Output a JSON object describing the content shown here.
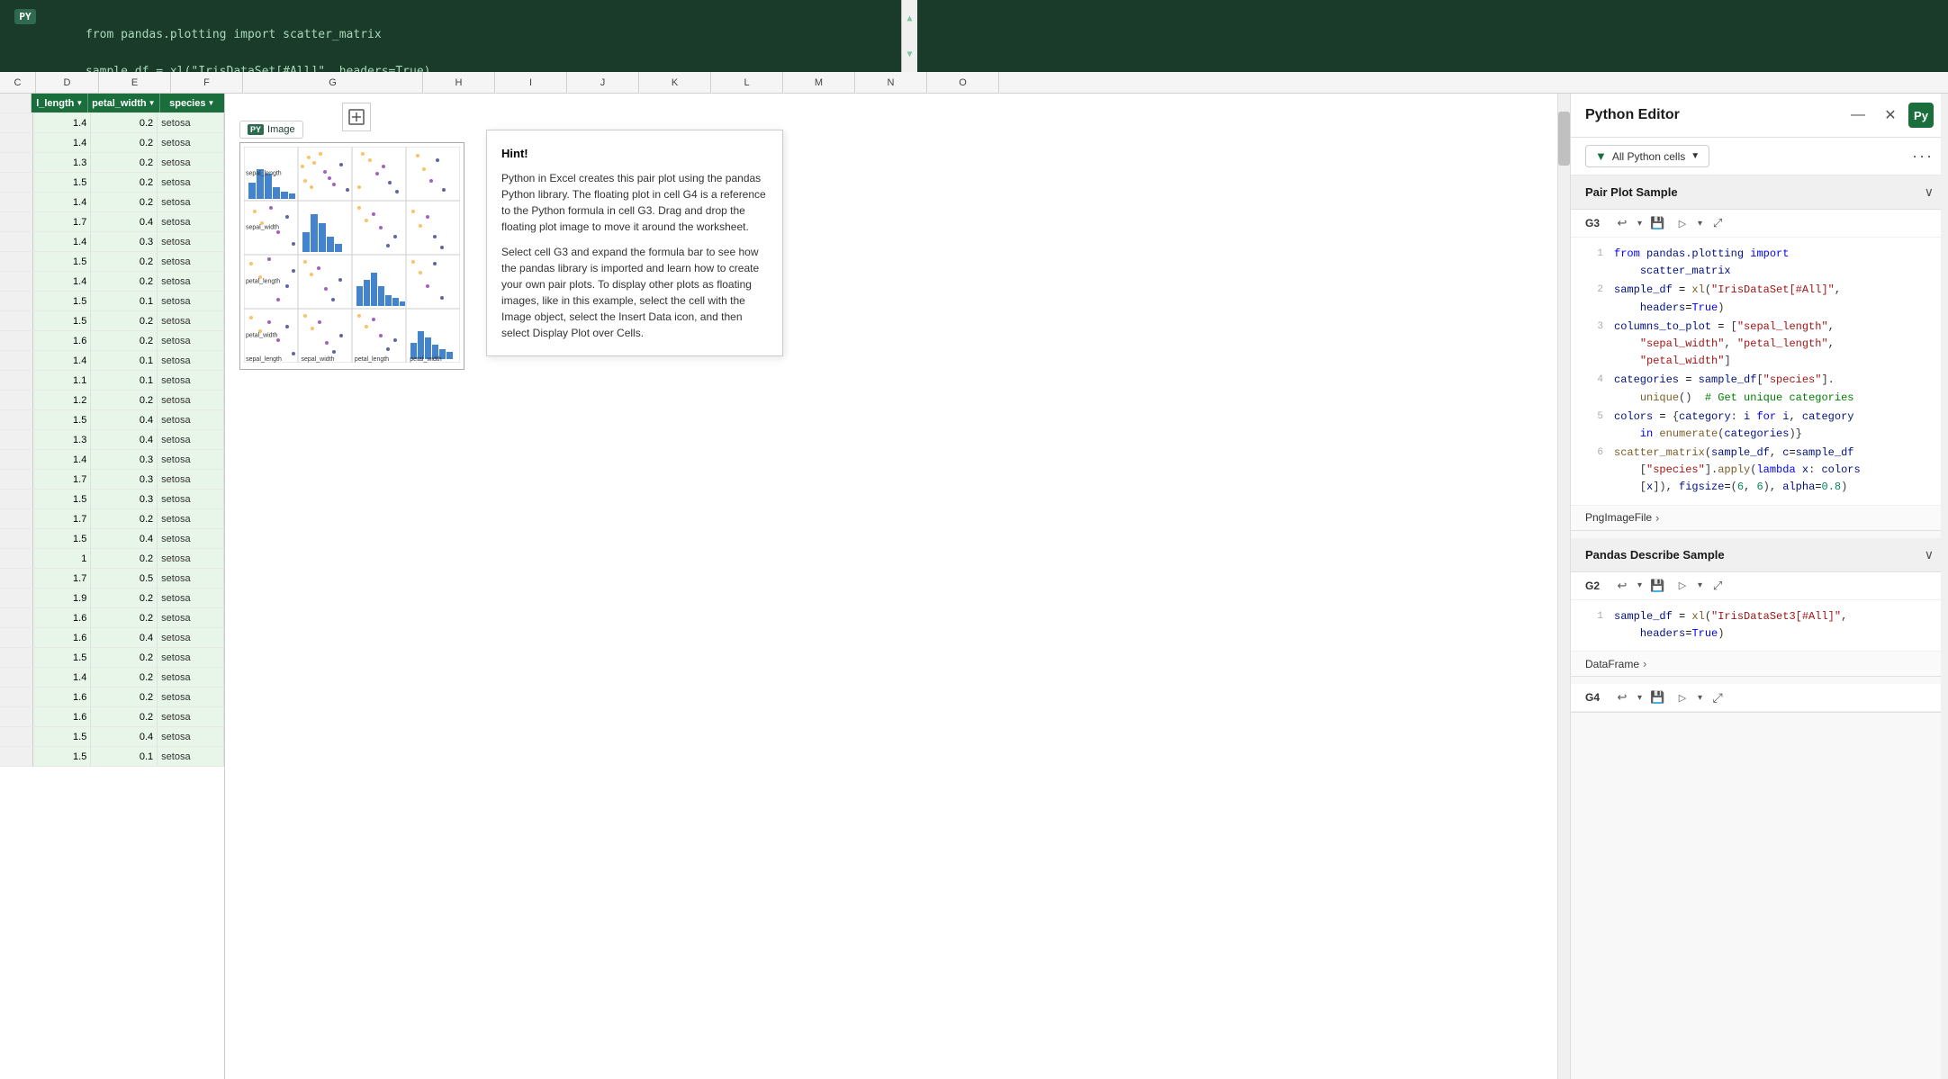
{
  "formula_bar": {
    "py_label": "PY",
    "line1": "from pandas.plotting import scatter_matrix",
    "line2": "sample_df = xl(\"IrisDataSet[#All]\", headers=True)",
    "line3": "columns_to_plot = [\"sepal_length\", \"sepal_width\", \"petal_length\", \"petal_width\"]"
  },
  "spreadsheet": {
    "col_headers": [
      "C",
      "D",
      "E",
      "F",
      "G",
      "H",
      "I",
      "J",
      "K",
      "L",
      "M",
      "N",
      "O"
    ],
    "columns": {
      "petal_length": "l_length",
      "petal_width": "petal_width",
      "species": "species"
    },
    "rows": [
      {
        "petal_length": "1.4",
        "petal_width": "0.2",
        "species": "setosa"
      },
      {
        "petal_length": "1.4",
        "petal_width": "0.2",
        "species": "setosa"
      },
      {
        "petal_length": "1.3",
        "petal_width": "0.2",
        "species": "setosa"
      },
      {
        "petal_length": "1.5",
        "petal_width": "0.2",
        "species": "setosa"
      },
      {
        "petal_length": "1.4",
        "petal_width": "0.2",
        "species": "setosa"
      },
      {
        "petal_length": "1.7",
        "petal_width": "0.4",
        "species": "setosa"
      },
      {
        "petal_length": "1.4",
        "petal_width": "0.3",
        "species": "setosa"
      },
      {
        "petal_length": "1.5",
        "petal_width": "0.2",
        "species": "setosa"
      },
      {
        "petal_length": "1.4",
        "petal_width": "0.2",
        "species": "setosa"
      },
      {
        "petal_length": "1.5",
        "petal_width": "0.1",
        "species": "setosa"
      },
      {
        "petal_length": "1.5",
        "petal_width": "0.2",
        "species": "setosa"
      },
      {
        "petal_length": "1.6",
        "petal_width": "0.2",
        "species": "setosa"
      },
      {
        "petal_length": "1.4",
        "petal_width": "0.1",
        "species": "setosa"
      },
      {
        "petal_length": "1.1",
        "petal_width": "0.1",
        "species": "setosa"
      },
      {
        "petal_length": "1.2",
        "petal_width": "0.2",
        "species": "setosa"
      },
      {
        "petal_length": "1.5",
        "petal_width": "0.4",
        "species": "setosa"
      },
      {
        "petal_length": "1.3",
        "petal_width": "0.4",
        "species": "setosa"
      },
      {
        "petal_length": "1.4",
        "petal_width": "0.3",
        "species": "setosa"
      },
      {
        "petal_length": "1.7",
        "petal_width": "0.3",
        "species": "setosa"
      },
      {
        "petal_length": "1.5",
        "petal_width": "0.3",
        "species": "setosa"
      },
      {
        "petal_length": "1.7",
        "petal_width": "0.2",
        "species": "setosa"
      },
      {
        "petal_length": "1.5",
        "petal_width": "0.4",
        "species": "setosa"
      },
      {
        "petal_length": "1.0",
        "petal_width": "0.2",
        "species": "setosa"
      },
      {
        "petal_length": "1.7",
        "petal_width": "0.5",
        "species": "setosa"
      },
      {
        "petal_length": "1.9",
        "petal_width": "0.2",
        "species": "setosa"
      },
      {
        "petal_length": "1.6",
        "petal_width": "0.2",
        "species": "setosa"
      },
      {
        "petal_length": "1.6",
        "petal_width": "0.4",
        "species": "setosa"
      },
      {
        "petal_length": "1.5",
        "petal_width": "0.2",
        "species": "setosa"
      },
      {
        "petal_length": "1.4",
        "petal_width": "0.2",
        "species": "setosa"
      },
      {
        "petal_length": "1.6",
        "petal_width": "0.2",
        "species": "setosa"
      },
      {
        "petal_length": "1.6",
        "petal_width": "0.2",
        "species": "setosa"
      },
      {
        "petal_length": "1.5",
        "petal_width": "0.4",
        "species": "setosa"
      },
      {
        "petal_length": "1.5",
        "petal_width": "0.1",
        "species": "setosa"
      }
    ]
  },
  "chart": {
    "cell_ref": "Image",
    "py_label": "PY",
    "axis_labels": [
      "sepal_length",
      "sepal_width",
      "petal_length",
      "petal_width"
    ]
  },
  "insert_icon": "⊞",
  "hint": {
    "title": "Hint!",
    "paragraphs": [
      "Python in Excel creates this pair plot using the pandas Python library. The floating plot in cell G4 is a reference to the Python formula in cell G3. Drag and drop the floating plot image to move it around the worksheet.",
      "Select cell G3 and expand the formula bar to see how the pandas library is imported and learn how to create your own pair plots. To display other plots as floating images, like in this example, select the cell with the Image object, select the Insert Data icon, and then select Display Plot over Cells."
    ]
  },
  "python_editor": {
    "title": "Python Editor",
    "close_icon": "✕",
    "minimize_icon": "—",
    "py_icon": "Py",
    "filter_label": "All Python cells",
    "more_label": "···",
    "sections": [
      {
        "title": "Pair Plot Sample",
        "cell_ref": "G3",
        "code_lines": [
          {
            "num": 1,
            "code": "from pandas.plotting import\nscatter_matrix"
          },
          {
            "num": 2,
            "code": "sample_df = xl(\"IrisDataSet[#All]\",\nheaders=True)"
          },
          {
            "num": 3,
            "code": "columns_to_plot = [\"sepal_length\",\n\"sepal_width\", \"petal_length\",\n\"petal_width\"]"
          },
          {
            "num": 4,
            "code": "categories = sample_df[\"species\"].\nunique()  # Get unique categories"
          },
          {
            "num": 5,
            "code": "colors = {category: i for i, category\nin enumerate(categories)}"
          },
          {
            "num": 6,
            "code": "scatter_matrix(sample_df, c=sample_df\n[\"species\"].apply(lambda x: colors\n[x]), figsize=(6, 6), alpha=0.8)"
          }
        ],
        "output_label": "PngImageFile",
        "output_chevron": "›"
      },
      {
        "title": "Pandas Describe Sample",
        "cell_ref": "G2",
        "code_lines": [
          {
            "num": 1,
            "code": "sample_df = xl(\"IrisDataSet3[#All]\",\nheaders=True)"
          }
        ],
        "output_label": "DataFrame",
        "output_chevron": "›"
      }
    ],
    "g4_cell_ref": "G4",
    "toolbar_icons": {
      "undo": "↩",
      "save": "💾",
      "run": "▷",
      "expand": "⤢"
    }
  }
}
